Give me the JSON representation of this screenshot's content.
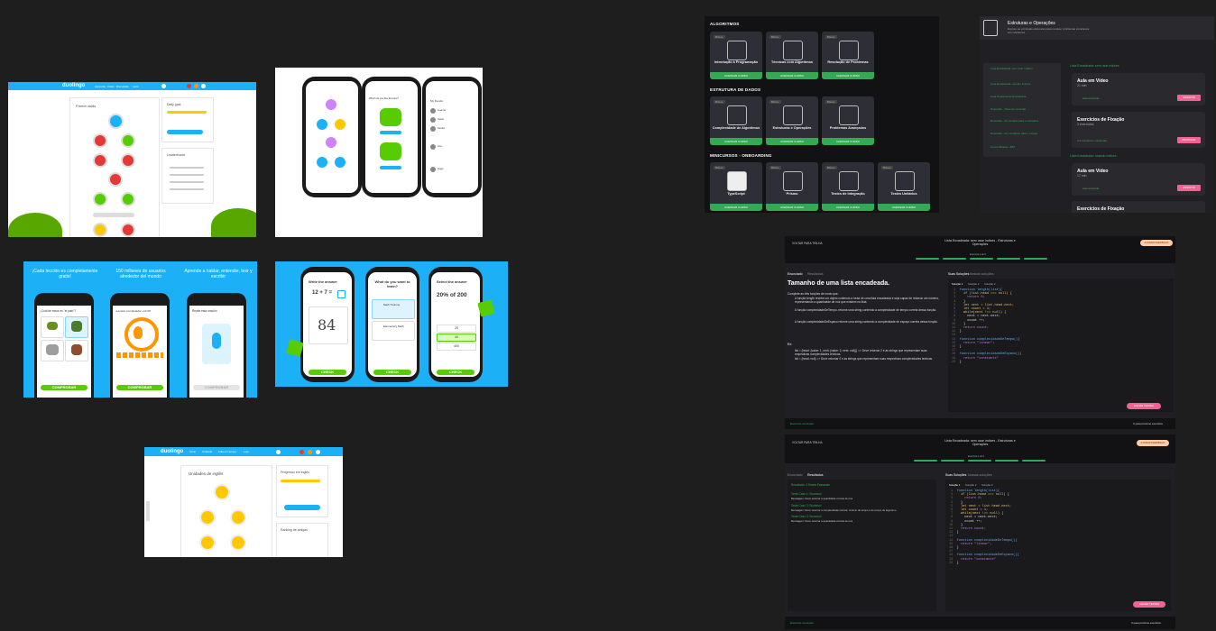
{
  "duo_web1": {
    "logo": "duolingo",
    "menu": [
      "Aprender",
      "Clubs",
      "Discussão",
      "Labs",
      "Shop"
    ],
    "title": "French skills",
    "daily_goal": "Daily goal",
    "leaderboard": "Leaderboard",
    "skills": [
      "Basics 1",
      "Phrases",
      "Food",
      "Animals",
      "Basics 2",
      "Clothing",
      "Plurals"
    ],
    "btn": "Practice"
  },
  "duo_phones1": {
    "screen2_title": "Which do you like the best?",
    "screen3_title": "My friends",
    "friends": [
      "Luanna",
      "Jacob",
      "Kenda",
      "Ana",
      "Hugo"
    ]
  },
  "duo_promo_es": {
    "headings": [
      "¡Cada lección es completamente gratis!",
      "150 millones de usuarios alrededor del mundo",
      "Aprende a hablar, entender, leer y escribir"
    ],
    "q1": "¿Cuál de éstos es \"el pato\"?",
    "options": [
      "la tortuga",
      "el pato",
      "el elefante",
      "el oso"
    ],
    "q2": "¡Lección completada! +10 XP",
    "q3": "Repite esta oración",
    "btn": "COMPROBAR"
  },
  "duo_promo_en": {
    "p1_title": "Write the answer",
    "p1_expr": "12 + 7 =",
    "p1_hand": "84",
    "p2_title": "What do you want to learn?",
    "p2_opts": [
      "Math Training",
      "Elementary Math"
    ],
    "p3_title": "Select the answer",
    "p3_expr": "20% of 200",
    "p3_opts": [
      "20",
      "40",
      "400"
    ],
    "btn": "CHECK"
  },
  "duo_web2": {
    "logo": "duolingo",
    "menu": [
      "Início",
      "Unidade",
      "Fala em tempo",
      "Loja"
    ],
    "title": "Unidades de inglês",
    "side_title": "Progresso em inglês",
    "btn": "Reforçar unidade",
    "lb": "Ranking de amigos",
    "skills": [
      "Básico 1",
      "Frases",
      "Comida",
      "Saudações"
    ]
  },
  "course": {
    "sections": [
      "ALGORITMOS",
      "ESTRUTURA DE DADOS",
      "MINICURSOS - ONBOARDING"
    ],
    "row1": [
      {
        "tag": "Bônus",
        "title": "Introdução à Programação",
        "desc": "Aprenda os fundamentos da programação e algoritmos"
      },
      {
        "tag": "Bônus",
        "title": "Técnicas com Algoritmos",
        "desc": "Técnicas importantes para resolver problemas"
      },
      {
        "tag": "Bônus",
        "title": "Resolução de Problemas",
        "desc": "Pratique problemas clássicos de algoritmos"
      }
    ],
    "row2": [
      {
        "tag": "Bônus",
        "title": "Complexidade de Algoritmos",
        "desc": "Entenda a eficiência dos seus algoritmos"
      },
      {
        "tag": "Bônus",
        "title": "Estruturas e Operações",
        "desc": "Explore as principais estruturas"
      },
      {
        "tag": "Bônus",
        "title": "Problemas Avançados",
        "desc": "Desafios avançados de estruturas de dados"
      }
    ],
    "row3": [
      {
        "tag": "Bônus",
        "title": "TypeScript",
        "desc": "Aprenda o básico de TypeScript"
      },
      {
        "tag": "Bônus",
        "title": "Prisma",
        "desc": "O ORM do futuro"
      },
      {
        "tag": "Bônus",
        "title": "Testes de Integração",
        "desc": "Testes de integração com Jest"
      },
      {
        "tag": "Bônus",
        "title": "Testes Unitários",
        "desc": "Aprenda a escrever testes unitários"
      }
    ],
    "card_btn": "ACESSAR CURSO"
  },
  "module": {
    "title": "Estruturas e Operações",
    "desc": "Explore as principais estruturas para resolver problemas complexos com eficiência",
    "list": [
      "Lista Encadeada: sem usar índices",
      "Lista Encadeada: usando índices",
      "Lista Duplamente Encadeada",
      "Recursão - Teste de recursão",
      "Recursão - Do simples para o complexo",
      "Recursão - Do complexo para o código",
      "Árvore Binária - BST"
    ],
    "group1": "Lista Encadeada: sem usar índices",
    "group2": "Lista Encadeada: usando índices",
    "items": [
      {
        "title": "Aula em Vídeo",
        "meta": "21 min",
        "status": "aula assistida",
        "btn": "ASSISTIR"
      },
      {
        "title": "Exercícios de Fixação",
        "meta": "3 exercícios",
        "status": "3/4 exercícios concluídos",
        "btn": "PRATICAR"
      },
      {
        "title": "Aula em Vídeo",
        "meta": "17 min",
        "status": "aula assistida",
        "btn": "ASSISTIR"
      },
      {
        "title": "Exercícios de Fixação",
        "meta": "",
        "status": "",
        "btn": ""
      }
    ]
  },
  "editor1": {
    "back": "VOLTAR PARA TRILHA",
    "title": "Lista Encadeada: sem usar índices - Estruturas e Operações",
    "step": "Exercício 1 de 5",
    "help": "AJUDAR FEEDBACK",
    "tabs": [
      "Enunciado",
      "Resultados"
    ],
    "right_tabs": [
      "Suas Soluções",
      "Nossas soluções"
    ],
    "sol_tabs": [
      "Solução 1",
      "Solução 2",
      "Solução 3"
    ],
    "heading": "Tamanho de uma lista encadeada.",
    "text": "Complete as três funções de modo que:",
    "bullets": [
      "A função length recebe um objeto contendo a head de uma lista encadeada e seja capaz de retornar um número, representando a quantidade de nós que existem na lista.",
      "A função complexidadeDeTempo, retorne uma string contendo a complexidade de tempo correta dessa função.",
      "A função complexidadeDeEspaco retorne uma string contendo a complexidade de espaço correta dessa função."
    ],
    "example_label": "Ex:",
    "examples": [
      "list = {head: {value: 1, next: {value: 2, next: null}}} => Deve retornar 2 e as strings que representam suas respectivas complexidades teóricas.",
      "list = {head: null} => Deve retornar 0 e as strings que representam suas respectivas complexidades teóricas."
    ],
    "submit": "ENVIAR TESTES",
    "footer_left": "Exercício concluído",
    "footer_right": "Ir para próximo exercício"
  },
  "editor2": {
    "back": "VOLTAR PARA TRILHA",
    "title": "Lista Encadeada: sem usar índices - Estruturas e Operações",
    "step": "Exercício 1 de 5",
    "help": "AJUDAR FEEDBACK",
    "tabs": [
      "Enunciado",
      "Resultados"
    ],
    "right_tabs": [
      "Suas Soluções",
      "Nossas soluções"
    ],
    "sol_tabs": [
      "Solução 1",
      "Solução 2",
      "Solução 3"
    ],
    "result": "Resultado: 3 Testes Passaram",
    "cases": [
      {
        "title": "Teste Caso 1: Sucesso!",
        "msg": "Mensagem: Deve retornar a quantidade correta de nós"
      },
      {
        "title": "Teste Caso 2: Sucesso!",
        "msg": "Mensagem: Deve retornar a complexidade correta, mínimo de tempo e de tempo de algoritmo"
      },
      {
        "title": "Teste Caso 3: Sucesso!",
        "msg": "Mensagem: Deve retornar a quantidade correta de nós"
      }
    ],
    "submit": "ENVIAR TESTES",
    "footer_left": "Exercício concluído",
    "footer_right": "Ir para próximo exercício"
  },
  "code_lines": [
    "function length(list){",
    "  if (list.head === null) {",
    "    return 0;",
    "  }",
    "  let next = list.head.next;",
    "  let count = 1;",
    "  while(next !== null) {",
    "    next = next.next;",
    "    count ++;",
    "  }",
    "  return count;",
    "}",
    "",
    "function complexidadeDeTempo(){",
    "  return \"linear\";",
    "}",
    "",
    "function complexidadeDeEspaco(){",
    "  return \"constante\"",
    "}"
  ],
  "colors": {
    "duo_blue": "#1cb0f6",
    "duo_green": "#58cc02",
    "bg": "#1e1e1e",
    "accent_pink": "#f06292",
    "accent_green": "#34a853"
  }
}
